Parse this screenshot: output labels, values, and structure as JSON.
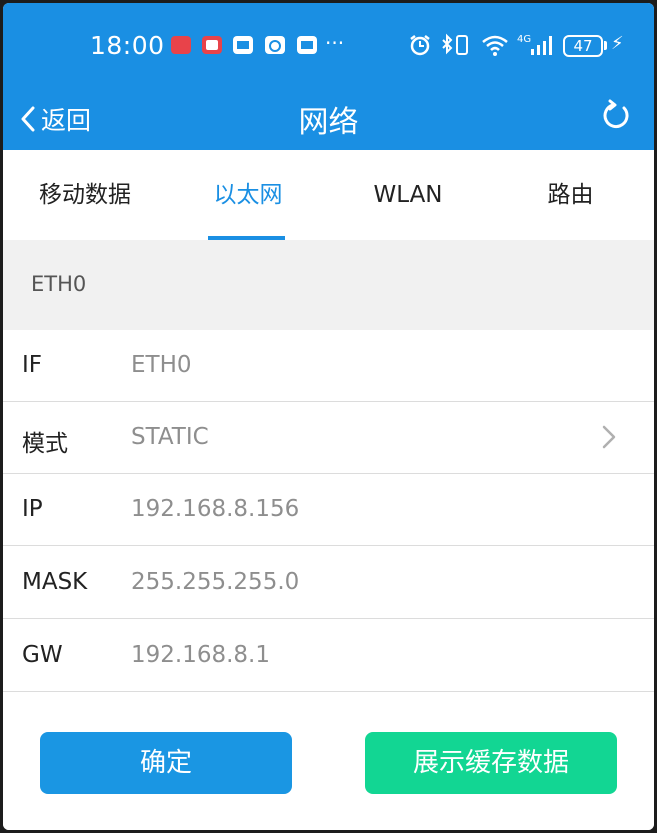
{
  "status_bar": {
    "time": "18:00",
    "more": "···",
    "battery": "47",
    "network": "4G"
  },
  "header": {
    "back_label": "返回",
    "title": "网络"
  },
  "tabs": [
    {
      "label": "移动数据",
      "active": false
    },
    {
      "label": "以太网",
      "active": true
    },
    {
      "label": "WLAN",
      "active": false
    },
    {
      "label": "路由",
      "active": false
    }
  ],
  "section": {
    "label": "ETH0"
  },
  "rows": [
    {
      "label": "IF",
      "value": "ETH0"
    },
    {
      "label": "模式",
      "value": "STATIC"
    },
    {
      "label": "IP",
      "value": "192.168.8.156"
    },
    {
      "label": "MASK",
      "value": "255.255.255.0"
    },
    {
      "label": "GW",
      "value": "192.168.8.1"
    }
  ],
  "buttons": {
    "confirm": "确定",
    "show_cache": "展示缓存数据"
  },
  "colors": {
    "primary": "#1a8fe3",
    "confirm_button": "#1a96e3",
    "cache_button": "#12d693"
  }
}
